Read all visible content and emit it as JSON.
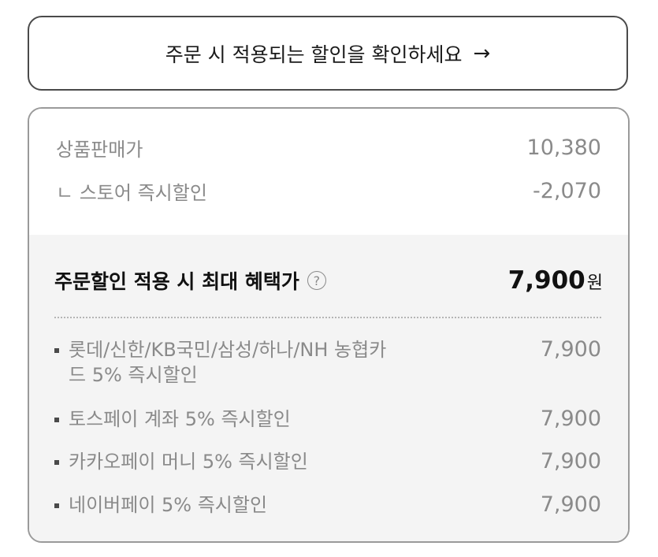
{
  "confirm_button": {
    "label": "주문 시 적용되는 할인을 확인하세요",
    "arrow": "→"
  },
  "price_summary": {
    "product_price_label": "상품판매가",
    "product_price_value": "10,380",
    "store_discount_label": "ㄴ 스토어 즉시할인",
    "store_discount_value": "-2,070"
  },
  "max_benefit": {
    "label": "주문할인 적용 시 최대 혜택가",
    "help_icon": "?",
    "price": "7,900",
    "unit": "원"
  },
  "discounts": [
    {
      "name": "롯데/신한/KB국민/삼성/하나/NH 농협카드 5% 즉시할인",
      "amount": "7,900"
    },
    {
      "name": "토스페이 계좌 5% 즉시할인",
      "amount": "7,900"
    },
    {
      "name": "카카오페이 머니 5% 즉시할인",
      "amount": "7,900"
    },
    {
      "name": "네이버페이 5% 즉시할인",
      "amount": "7,900"
    }
  ]
}
